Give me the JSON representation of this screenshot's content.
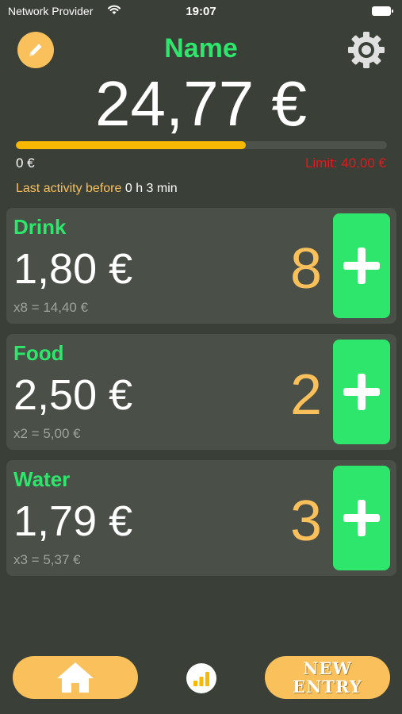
{
  "status_bar": {
    "carrier": "Network Provider",
    "time": "19:07"
  },
  "header": {
    "name": "Name",
    "total": "24,77 €"
  },
  "progress": {
    "value": 0.62,
    "min_label": "0 €",
    "limit_label": "Limit: 40,00 €"
  },
  "activity": {
    "prefix": "Last activity before",
    "value": "0 h 3 min"
  },
  "items": [
    {
      "name": "Drink",
      "price": "1,80 €",
      "summary": "x8 = 14,40 €",
      "count": "8"
    },
    {
      "name": "Food",
      "price": "2,50 €",
      "summary": "x2 = 5,00 €",
      "count": "2"
    },
    {
      "name": "Water",
      "price": "1,79 €",
      "summary": "x3 = 5,37 €",
      "count": "3"
    }
  ],
  "bottom_bar": {
    "new_entry_line1": "NEW",
    "new_entry_line2": "ENTRY"
  },
  "colors": {
    "background": "#3a3f37",
    "card": "#4a5047",
    "accent_green": "#2ee66b",
    "accent_orange": "#f9c05b",
    "limit_red": "#e5181b",
    "progress": "#f9b800"
  },
  "icons": {
    "edit": "pencil-icon",
    "settings": "gear-icon",
    "add": "plus-icon",
    "home": "home-icon",
    "stats": "bar-chart-icon",
    "wifi": "wifi-icon",
    "battery": "battery-icon"
  }
}
